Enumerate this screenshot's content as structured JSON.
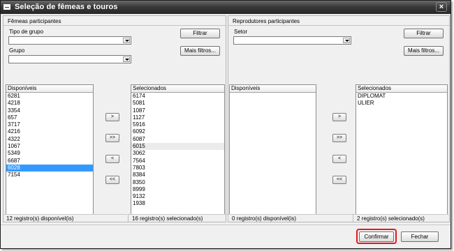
{
  "window": {
    "title": "Seleção de fêmeas e touros",
    "close_label": "×"
  },
  "left": {
    "section_title": "Fêmeas participantes",
    "tipo_label": "Tipo de grupo",
    "grupo_label": "Grupo",
    "filtrar": "Filtrar",
    "mais_filtros": "Mais filtros...",
    "available_header": "Disponíveis",
    "selected_header": "Selecionados",
    "available_items": [
      "6281",
      "4218",
      "3354",
      "657",
      "3717",
      "4216",
      "4322",
      "1067",
      "5349",
      "6687",
      "6028",
      "7154"
    ],
    "available_selected_item": "6028",
    "selected_items": [
      "6174",
      "5081",
      "1087",
      "1127",
      "5916",
      "6092",
      "6087",
      "6015",
      "3062",
      "7564",
      "7803",
      "8384",
      "8350",
      "8999",
      "9132",
      "1938"
    ],
    "selected_alt_item": "6015",
    "status_available": "12 registro(s) disponível(is)",
    "status_selected": "16 registro(s) selecionado(s)"
  },
  "right": {
    "section_title": "Reprodutores participantes",
    "setor_label": "Setor",
    "filtrar": "Filtrar",
    "mais_filtros": "Mais filtros...",
    "available_header": "Disponíveis",
    "selected_header": "Selecionados",
    "available_items": [],
    "selected_items": [
      "DIPLOMAT",
      "ULIER"
    ],
    "status_available": "0 registro(s) disponível(is)",
    "status_selected": "2 registro(s) selecionado(s)"
  },
  "move_buttons": {
    "add": ">",
    "add_all": ">>",
    "remove": "<",
    "remove_all": "<<"
  },
  "footer": {
    "confirm": "Confirmar",
    "close": "Fechar",
    "highlight_color": "#e21a1a"
  }
}
